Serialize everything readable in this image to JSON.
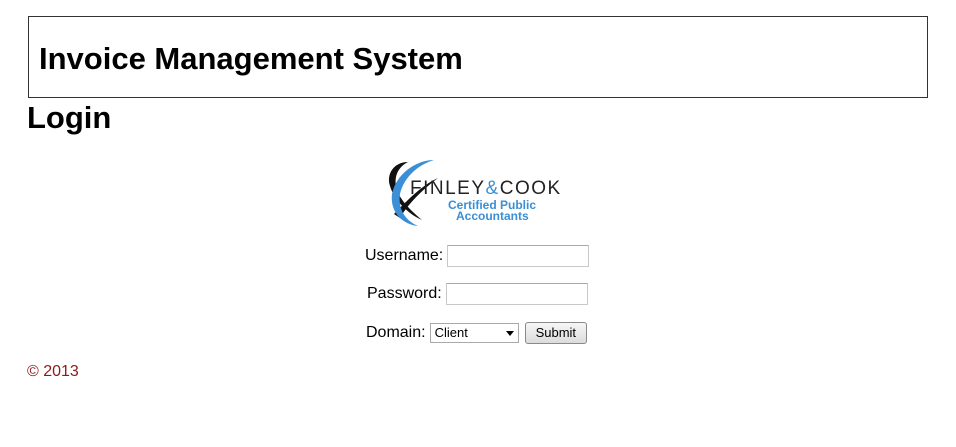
{
  "header": {
    "app_title": "Invoice Management System"
  },
  "page": {
    "heading": "Login"
  },
  "logo": {
    "brand_left": "FINLEY",
    "brand_amp": "&",
    "brand_right": "COOK",
    "tagline_line1": "Certified Public",
    "tagline_line2": "Accountants",
    "colors": {
      "text": "#222222",
      "accent": "#3a8fd6"
    }
  },
  "form": {
    "username_label": "Username:",
    "username_value": "",
    "password_label": "Password:",
    "password_value": "",
    "domain_label": "Domain:",
    "domain_selected": "Client",
    "submit_label": "Submit"
  },
  "footer": {
    "copyright": "© 2013",
    "color": "#8b1a1a"
  }
}
